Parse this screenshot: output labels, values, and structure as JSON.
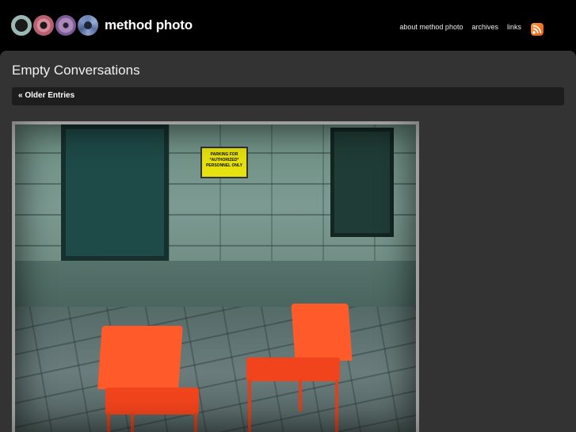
{
  "site": {
    "logo_text": "method photo",
    "nav": [
      {
        "label": "about method photo"
      },
      {
        "label": "archives"
      },
      {
        "label": "links"
      }
    ],
    "rss_icon": "rss-icon"
  },
  "post": {
    "title": "Empty Conversations",
    "older_entries": "« Older Entries",
    "photo": {
      "sign_text": "PARKING FOR *AUTHORIZED* PERSONNEL ONLY"
    }
  },
  "colors": {
    "header_bg": "#000000",
    "content_bg": "#333333",
    "navbar_bg": "#1d1d1d",
    "chair": "#f2441c",
    "rss": "#e8590c"
  }
}
